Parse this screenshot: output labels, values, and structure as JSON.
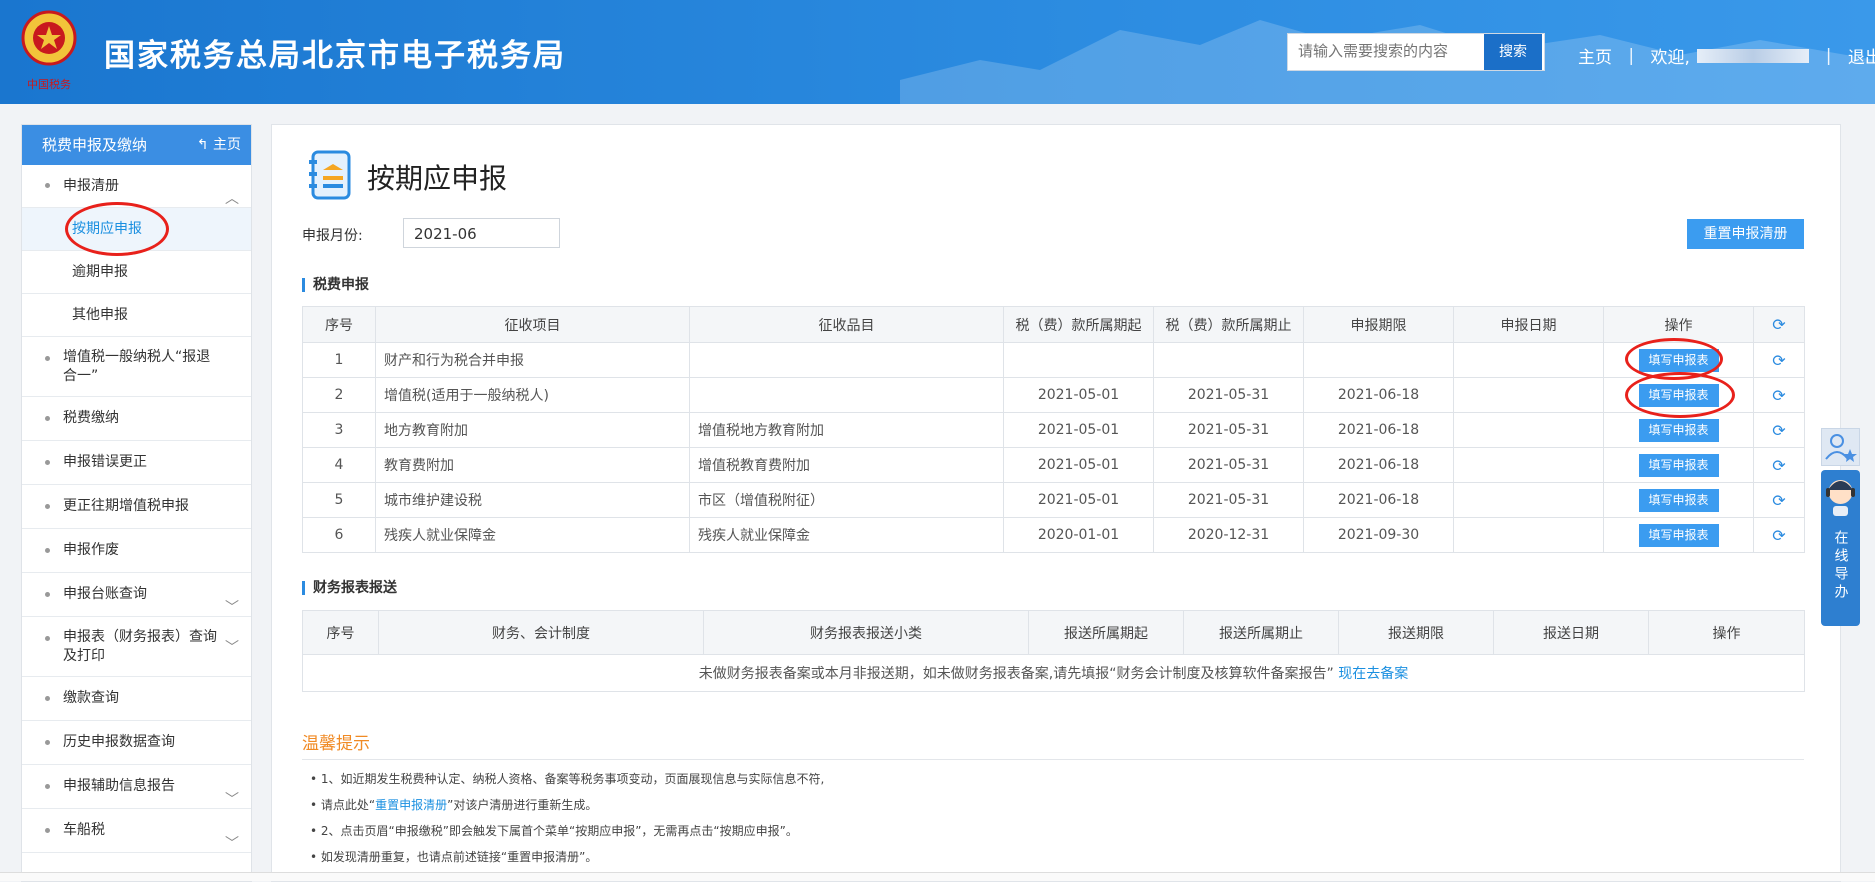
{
  "header": {
    "site_title": "国家税务总局北京市电子税务局",
    "search_placeholder": "请输入需要搜索的内容",
    "search_button": "搜索",
    "nav_home": "主页",
    "nav_welcome": "欢迎,",
    "nav_logout": "退出",
    "emblem_caption": "中国税务"
  },
  "sidebar": {
    "header_title": "税费申报及缴纳",
    "header_home": "主页",
    "items": [
      {
        "label": "申报清册",
        "expandable": true
      },
      {
        "label": "按期应申报",
        "sub": true,
        "active": true
      },
      {
        "label": "逾期申报",
        "sub": true
      },
      {
        "label": "其他申报",
        "sub": true
      },
      {
        "label": "增值税一般纳税人“报退合一”",
        "expandable": false
      },
      {
        "label": "税费缴纳",
        "expandable": false
      },
      {
        "label": "申报错误更正",
        "expandable": false
      },
      {
        "label": "更正往期增值税申报",
        "expandable": false
      },
      {
        "label": "申报作废",
        "expandable": false
      },
      {
        "label": "申报台账查询",
        "expandable": true
      },
      {
        "label": "申报表（财务报表）查询及打印",
        "expandable": true
      },
      {
        "label": "缴款查询",
        "expandable": false
      },
      {
        "label": "历史申报数据查询",
        "expandable": false
      },
      {
        "label": "申报辅助信息报告",
        "expandable": true
      },
      {
        "label": "车船税",
        "expandable": true
      }
    ]
  },
  "main": {
    "page_title": "按期应申报",
    "month_label": "申报月份:",
    "month_value": "2021-06",
    "reset_button": "重置申报清册",
    "tax_section_title": "税费申报",
    "tax_table": {
      "headers": [
        "序号",
        "征收项目",
        "征收品目",
        "税（费）款所属期起",
        "税（费）款所属期止",
        "申报期限",
        "申报日期",
        "操作"
      ],
      "rows": [
        {
          "no": "1",
          "item": "财产和行为税合并申报",
          "subitem": "",
          "start": "",
          "end": "",
          "deadline": "",
          "date": "",
          "action": "填写申报表"
        },
        {
          "no": "2",
          "item": "增值税(适用于一般纳税人)",
          "subitem": "",
          "start": "2021-05-01",
          "end": "2021-05-31",
          "deadline": "2021-06-18",
          "date": "",
          "action": "填写申报表"
        },
        {
          "no": "3",
          "item": "地方教育附加",
          "subitem": "增值税地方教育附加",
          "start": "2021-05-01",
          "end": "2021-05-31",
          "deadline": "2021-06-18",
          "date": "",
          "action": "填写申报表"
        },
        {
          "no": "4",
          "item": "教育费附加",
          "subitem": "增值税教育费附加",
          "start": "2021-05-01",
          "end": "2021-05-31",
          "deadline": "2021-06-18",
          "date": "",
          "action": "填写申报表"
        },
        {
          "no": "5",
          "item": "城市维护建设税",
          "subitem": "市区（增值税附征）",
          "start": "2021-05-01",
          "end": "2021-05-31",
          "deadline": "2021-06-18",
          "date": "",
          "action": "填写申报表"
        },
        {
          "no": "6",
          "item": "残疾人就业保障金",
          "subitem": "残疾人就业保障金",
          "start": "2020-01-01",
          "end": "2020-12-31",
          "deadline": "2021-09-30",
          "date": "",
          "action": "填写申报表"
        }
      ]
    },
    "fin_section_title": "财务报表报送",
    "fin_table": {
      "headers": [
        "序号",
        "财务、会计制度",
        "财务报表报送小类",
        "报送所属期起",
        "报送所属期止",
        "报送期限",
        "报送日期",
        "操作"
      ],
      "notice": "未做财务报表备案或本月非报送期，如未做财务报表备案,请先填报“财务会计制度及核算软件备案报告”",
      "notice_link": "现在去备案"
    },
    "tips": {
      "title": "温馨提示",
      "line1": "1、如近期发生税费种认定、纳税人资格、备案等税务事项变动，页面展现信息与实际信息不符,",
      "line2_pre": "请点此处“",
      "line2_link": "重置申报清册",
      "line2_post": "”对该户清册进行重新生成。",
      "line3": "2、点击页眉“申报缴税”即会触发下属首个菜单“按期应申报”，无需再点击“按期应申报”。",
      "line4": "如发现清册重复，也请点前述链接“重置申报清册”。"
    }
  },
  "float_widget": {
    "label": "在线导办"
  },
  "colors": {
    "header_blue": "#2b8be0",
    "button_blue": "#3b9cf0",
    "highlight_red": "#e8211b",
    "tips_orange": "#f08a24"
  }
}
